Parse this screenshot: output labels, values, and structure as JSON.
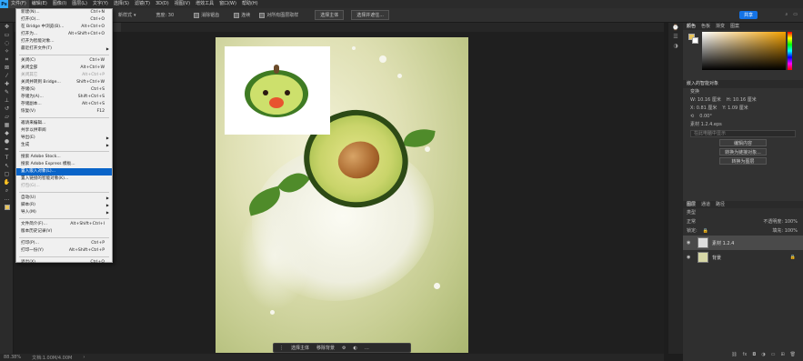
{
  "menubar": {
    "logo": "Ps",
    "items": [
      "文件(F)",
      "编辑(E)",
      "图像(I)",
      "图层(L)",
      "文字(Y)",
      "选择(S)",
      "滤镜(T)",
      "3D(D)",
      "视图(V)",
      "增效工具",
      "窗口(W)",
      "帮助(H)"
    ]
  },
  "optionsbar": {
    "style_label": "新样式",
    "size_label": "宽度: 30",
    "antialias_label": "消除锯齿",
    "sample_all_label": "连续",
    "all_layers_label": "对所有图层取样",
    "select_subject": "选择主体",
    "select_and_mask": "选择并遮住...",
    "share": "共享"
  },
  "doc_tab": "",
  "filemenu": {
    "items": [
      {
        "label": "新建(N)...",
        "shortcut": "Ctrl+N"
      },
      {
        "label": "打开(O)...",
        "shortcut": "Ctrl+O"
      },
      {
        "label": "在 Bridge 中浏览(B)...",
        "shortcut": "Alt+Ctrl+O"
      },
      {
        "label": "打开为...",
        "shortcut": "Alt+Shift+Ctrl+O"
      },
      {
        "label": "打开为智能对象...",
        "shortcut": ""
      },
      {
        "label": "最近打开文件(T)",
        "shortcut": "",
        "arrow": true
      },
      {
        "sep": true
      },
      {
        "label": "关闭(C)",
        "shortcut": "Ctrl+W"
      },
      {
        "label": "关闭全部",
        "shortcut": "Alt+Ctrl+W"
      },
      {
        "label": "关闭其它",
        "shortcut": "Alt+Ctrl+P",
        "disabled": true
      },
      {
        "label": "关闭并转到 Bridge...",
        "shortcut": "Shift+Ctrl+W"
      },
      {
        "label": "存储(S)",
        "shortcut": "Ctrl+S"
      },
      {
        "label": "存储为(A)...",
        "shortcut": "Shift+Ctrl+S"
      },
      {
        "label": "存储副本...",
        "shortcut": "Alt+Ctrl+S"
      },
      {
        "label": "恢复(V)",
        "shortcut": "F12"
      },
      {
        "sep": true
      },
      {
        "label": "邀请来编辑...",
        "shortcut": ""
      },
      {
        "label": "共享以供审阅",
        "shortcut": ""
      },
      {
        "label": "导出(E)",
        "shortcut": "",
        "arrow": true
      },
      {
        "label": "生成",
        "shortcut": "",
        "arrow": true
      },
      {
        "sep": true
      },
      {
        "label": "搜索 Adobe Stock...",
        "shortcut": ""
      },
      {
        "label": "搜索 Adobe Express 模板...",
        "shortcut": ""
      },
      {
        "label": "置入嵌入对象(L)...",
        "shortcut": "",
        "highlight": true
      },
      {
        "label": "置入链接的智能对象(K)...",
        "shortcut": ""
      },
      {
        "label": "打包(G)...",
        "shortcut": "",
        "disabled": true
      },
      {
        "sep": true
      },
      {
        "label": "自动(U)",
        "shortcut": "",
        "arrow": true
      },
      {
        "label": "脚本(R)",
        "shortcut": "",
        "arrow": true
      },
      {
        "label": "导入(M)",
        "shortcut": "",
        "arrow": true
      },
      {
        "sep": true
      },
      {
        "label": "文件简介(F)...",
        "shortcut": "Alt+Shift+Ctrl+I"
      },
      {
        "label": "版本历史记录(V)",
        "shortcut": ""
      },
      {
        "sep": true
      },
      {
        "label": "打印(P)...",
        "shortcut": "Ctrl+P"
      },
      {
        "label": "打印一份(Y)",
        "shortcut": "Alt+Shift+Ctrl+P"
      },
      {
        "sep": true
      },
      {
        "label": "退出(X)",
        "shortcut": "Ctrl+Q"
      }
    ]
  },
  "context_bar": {
    "select_subject": "选择主体",
    "remove_bg": "移除背景"
  },
  "status": {
    "zoom": "88.38%",
    "doc_info": "文档:1.00M/4.00M"
  },
  "panels": {
    "tabs": [
      "颜色",
      "色板",
      "渐变",
      "图案"
    ],
    "props_title": "嵌入的智能对象",
    "transform_label": "变换",
    "w_label": "W: 10.16 厘米",
    "h_label": "H: 10.16 厘米",
    "x_label": "X: 0.81 厘米",
    "y_label": "Y: 1.09 厘米",
    "angle": "0.00°",
    "source_label": "素材 1.2.4.eps",
    "source_path": "在此电脑中显示",
    "btn_edit": "编辑内容",
    "btn_convert_linked": "转换为链接对象...",
    "btn_convert_layers": "转换为图层",
    "layers_tabs": [
      "图层",
      "通道",
      "路径"
    ],
    "kind_label": "类型",
    "blend_mode": "正常",
    "opacity": "不透明度: 100%",
    "lock_label": "锁定:",
    "fill": "填充: 100%",
    "layer1": "素材 1.2.4",
    "layer_bg": "背景"
  }
}
